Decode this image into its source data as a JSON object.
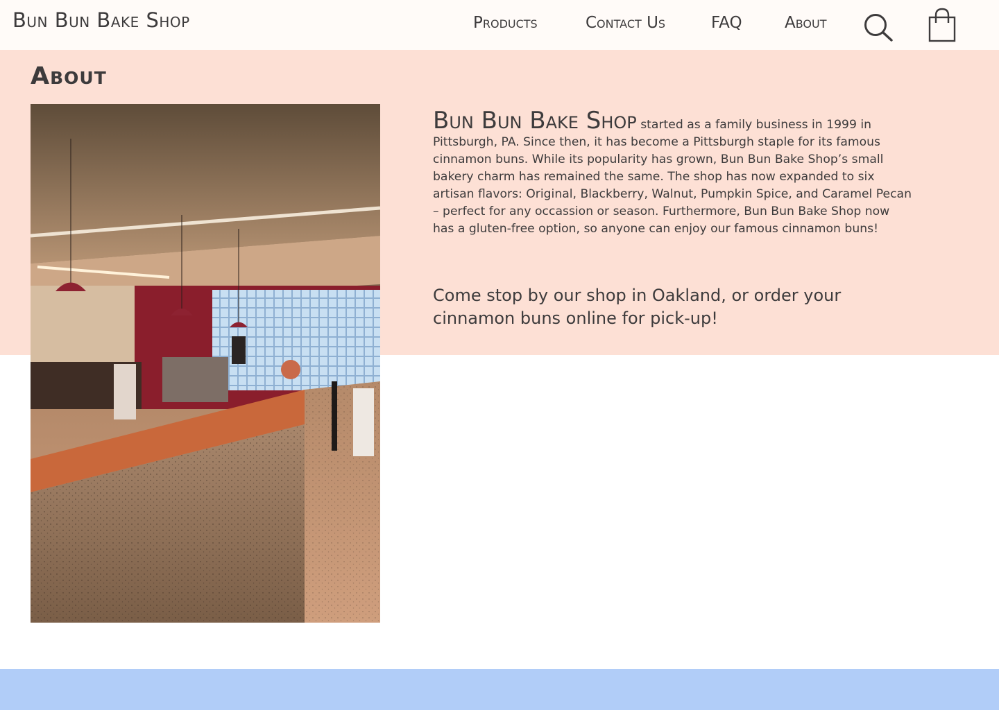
{
  "header": {
    "brand": "Bun Bun Bake Shop",
    "nav": {
      "products": "Products",
      "contact": "Contact Us",
      "faq": "FAQ",
      "about": "About"
    },
    "icons": {
      "search": "search-icon",
      "cart": "shopping-bag-icon"
    }
  },
  "about": {
    "title": "About",
    "photo": "bakery-counter-interior",
    "brand_name": "Bun Bun Bake Shop",
    "story": "started as a family business in 1999 in Pittsburgh, PA. Since then, it has become a Pittsburgh staple for its famous cinnamon buns. While its popularity has grown, Bun Bun Bake Shop’s small bakery charm has remained the same. The shop has now expanded to six artisan flavors: Original, Blackberry, Walnut, Pumpkin Spice, and Caramel Pecan – perfect for any occassion or season. Furthermore, Bun Bun Bake Shop now has a gluten-free option, so anyone can enjoy our famous cinnamon buns!",
    "visit": "Come stop by our shop in Oakland, or order your cinnamon buns online for pick-up!"
  },
  "colors": {
    "header_bg": "#fffbf8",
    "about_bg": "#fde0d5",
    "footer_bg": "#b1cdf8",
    "text": "#3d3b3c"
  }
}
